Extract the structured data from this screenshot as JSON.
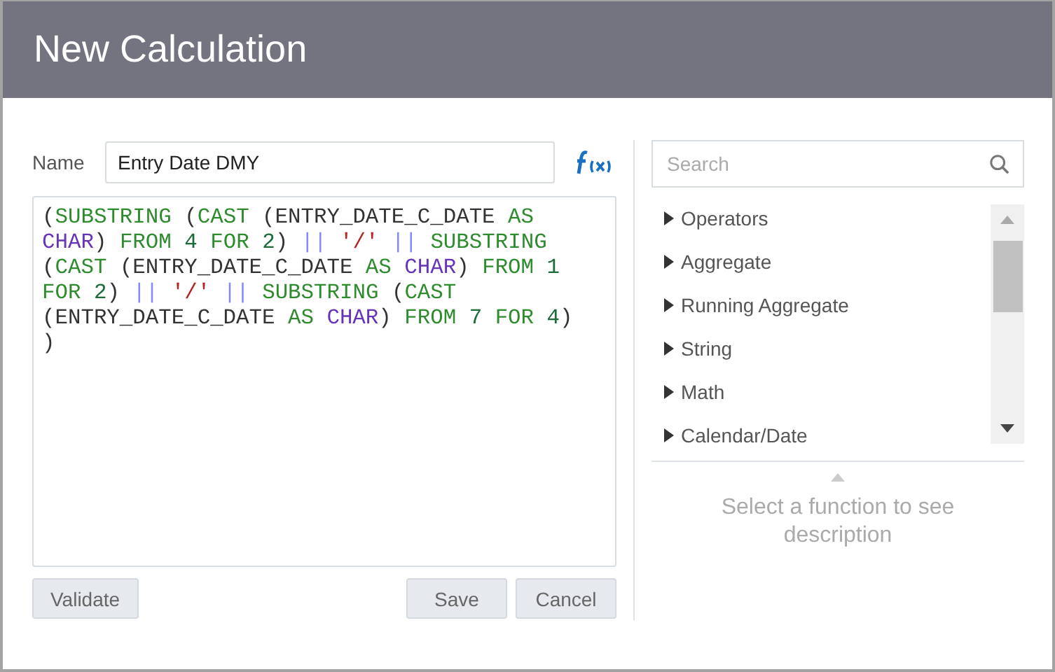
{
  "window": {
    "title": "New Calculation"
  },
  "name_field": {
    "label": "Name",
    "value": "Entry Date DMY"
  },
  "code_lines": [
    [
      {
        "kind": "plain",
        "text": "("
      },
      {
        "kind": "keyword",
        "text": "SUBSTRING"
      },
      {
        "kind": "plain",
        "text": " ("
      },
      {
        "kind": "keyword",
        "text": "CAST"
      },
      {
        "kind": "plain",
        "text": " (ENTRY_DATE_C_DATE "
      },
      {
        "kind": "keyword",
        "text": "AS"
      }
    ],
    [
      {
        "kind": "type",
        "text": "CHAR"
      },
      {
        "kind": "plain",
        "text": ") "
      },
      {
        "kind": "keyword",
        "text": "FROM"
      },
      {
        "kind": "number",
        "text": " 4"
      },
      {
        "kind": "keyword",
        "text": " FOR"
      },
      {
        "kind": "number",
        "text": " 2"
      },
      {
        "kind": "plain",
        "text": ") "
      },
      {
        "kind": "operator",
        "text": "||"
      },
      {
        "kind": "string",
        "text": " '/'"
      },
      {
        "kind": "operator",
        "text": " ||"
      },
      {
        "kind": "keyword",
        "text": " SUBSTRING"
      }
    ],
    [
      {
        "kind": "plain",
        "text": "("
      },
      {
        "kind": "keyword",
        "text": "CAST"
      },
      {
        "kind": "plain",
        "text": " (ENTRY_DATE_C_DATE "
      },
      {
        "kind": "keyword",
        "text": "AS"
      },
      {
        "kind": "type",
        "text": " CHAR"
      },
      {
        "kind": "plain",
        "text": ") "
      },
      {
        "kind": "keyword",
        "text": "FROM"
      },
      {
        "kind": "number",
        "text": " 1"
      }
    ],
    [
      {
        "kind": "keyword",
        "text": "FOR"
      },
      {
        "kind": "number",
        "text": " 2"
      },
      {
        "kind": "plain",
        "text": ") "
      },
      {
        "kind": "operator",
        "text": "||"
      },
      {
        "kind": "string",
        "text": " '/'"
      },
      {
        "kind": "operator",
        "text": " ||"
      },
      {
        "kind": "keyword",
        "text": " SUBSTRING"
      },
      {
        "kind": "plain",
        "text": " ("
      },
      {
        "kind": "keyword",
        "text": "CAST"
      }
    ],
    [
      {
        "kind": "plain",
        "text": "(ENTRY_DATE_C_DATE "
      },
      {
        "kind": "keyword",
        "text": "AS"
      },
      {
        "kind": "type",
        "text": " CHAR"
      },
      {
        "kind": "plain",
        "text": ") "
      },
      {
        "kind": "keyword",
        "text": "FROM"
      },
      {
        "kind": "number",
        "text": " 7"
      },
      {
        "kind": "keyword",
        "text": " FOR"
      },
      {
        "kind": "number",
        "text": " 4"
      },
      {
        "kind": "plain",
        "text": ")"
      }
    ],
    [
      {
        "kind": "plain",
        "text": ")"
      }
    ]
  ],
  "buttons": [
    {
      "label": "Validate"
    },
    {
      "label": "Save"
    },
    {
      "label": "Cancel"
    }
  ],
  "search": {
    "placeholder": "Search"
  },
  "function_groups": [
    {
      "label": "Operators",
      "expanded": false
    },
    {
      "label": "Aggregate",
      "expanded": false
    },
    {
      "label": "Running Aggregate",
      "expanded": false
    },
    {
      "label": "String",
      "expanded": false
    },
    {
      "label": "Math",
      "expanded": false
    },
    {
      "label": "Calendar/Date",
      "expanded": false
    }
  ],
  "description": "Select a function to see description"
}
